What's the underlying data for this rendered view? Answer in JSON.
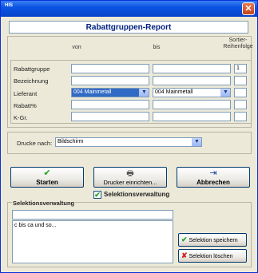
{
  "window": {
    "app_icon": "HIS",
    "close_glyph": "✕"
  },
  "report": {
    "title": "Rabattgruppen-Report"
  },
  "filter": {
    "header_von": "von",
    "header_bis": "bis",
    "header_sort": "Sortier-\nReihenfolge",
    "rows": [
      {
        "label": "Rabattgruppe",
        "von": "",
        "bis": "",
        "sort": "1"
      },
      {
        "label": "Bezeichnung",
        "von": "",
        "bis": "",
        "sort": ""
      },
      {
        "label": "Lieferant",
        "von": "004 Mainmetall",
        "bis": "004 Mainmetall",
        "sort": ""
      },
      {
        "label": "Rabatt%",
        "von": "",
        "bis": "",
        "sort": ""
      },
      {
        "label": "K-Gr.",
        "von": "",
        "bis": "",
        "sort": ""
      }
    ]
  },
  "print": {
    "label": "Drucke nach:",
    "value": "Bildschirm"
  },
  "buttons": {
    "start": "Starten",
    "printer": "Drucker einrichten...",
    "cancel": "Abbrechen"
  },
  "selection": {
    "checkbox_label": "Selektionsverwaltung",
    "checked": true,
    "group_title": "Selektionsverwaltung",
    "name_value": "",
    "list_items": [
      "c bis ca und so..."
    ],
    "save_label": "Selektion speichern",
    "delete_label": "Selektion löschen"
  },
  "colors": {
    "accent": "#0a54e3",
    "selected": "#316ac5",
    "ok_green": "#21a121",
    "delete_red": "#d42020"
  },
  "icons": {
    "start": "check-icon",
    "printer": "printer-icon",
    "cancel": "exit-door-icon",
    "save": "check-icon",
    "delete": "x-icon"
  }
}
